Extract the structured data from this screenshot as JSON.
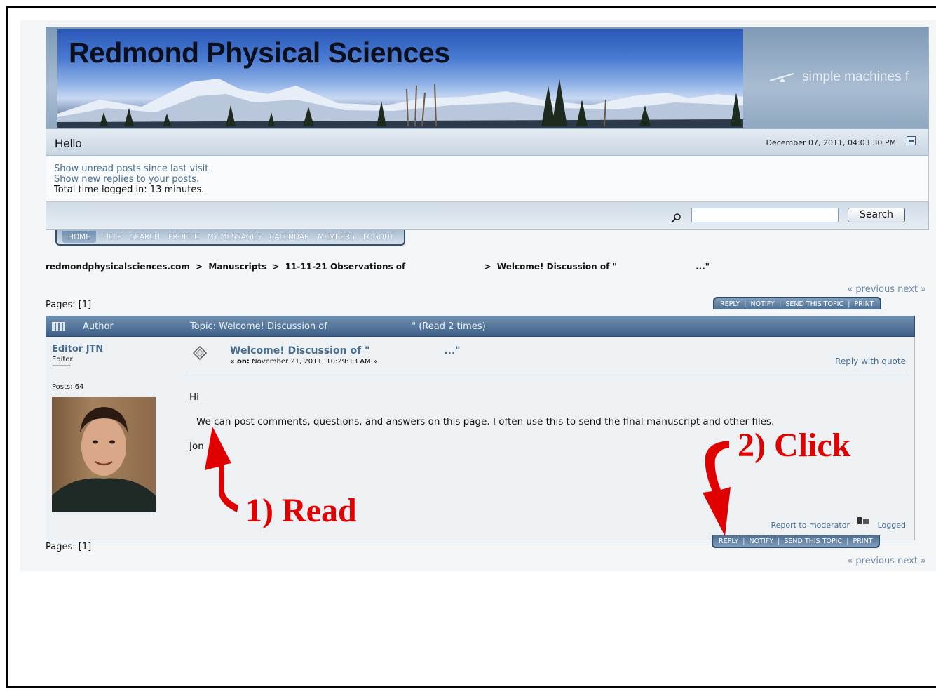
{
  "header": {
    "site_title": "Redmond Physical Sciences",
    "smf_text": "simple machines f"
  },
  "hello_bar": {
    "greeting": "Hello",
    "datetime": "December 07, 2011, 04:03:30 PM"
  },
  "user_links": {
    "unread": "Show unread posts since last visit.",
    "new_replies": "Show new replies to your posts.",
    "time_logged": "Total time logged in: 13 minutes."
  },
  "search": {
    "value": "",
    "button_label": "Search"
  },
  "menu": {
    "items": [
      "HOME",
      "HELP",
      "SEARCH",
      "PROFILE",
      "MY MESSAGES",
      "CALENDAR",
      "MEMBERS",
      "LOGOUT"
    ]
  },
  "breadcrumb": {
    "site": "redmondphysicalsciences.com",
    "sep": ">",
    "board": "Manuscripts",
    "topic_prefix": "11-11-21 Observations of",
    "current_prefix": "Welcome! Discussion of \"",
    "current_suffix": "...\""
  },
  "navigation": {
    "prev_next": "« previous next »",
    "pages": "Pages: [1]"
  },
  "topic_buttons": {
    "reply": "REPLY",
    "notify": "NOTIFY",
    "send": "SEND THIS TOPIC",
    "print": "PRINT"
  },
  "topic_header": {
    "author_label": "Author",
    "topic_prefix": "Topic: Welcome! Discussion of",
    "topic_suffix": "\" (Read 2 times)"
  },
  "poster": {
    "name": "Editor JTN",
    "rank": "Editor",
    "dashes": "----------",
    "posts": "Posts: 64"
  },
  "post": {
    "title_prefix": "Welcome! Discussion of \"",
    "title_suffix": "...\"",
    "date_label": "« on:",
    "date": "November 21, 2011, 10:29:13 AM »",
    "reply_with_quote": "Reply with quote",
    "body": [
      "Hi",
      "We can post comments, questions, and answers on this page. I often use this to send the final manuscript and other files.",
      "Jon"
    ],
    "report": "Report to moderator",
    "logged": "Logged"
  },
  "annotations": {
    "read": "1) Read",
    "click": "2) Click",
    "color": "#e00000"
  }
}
